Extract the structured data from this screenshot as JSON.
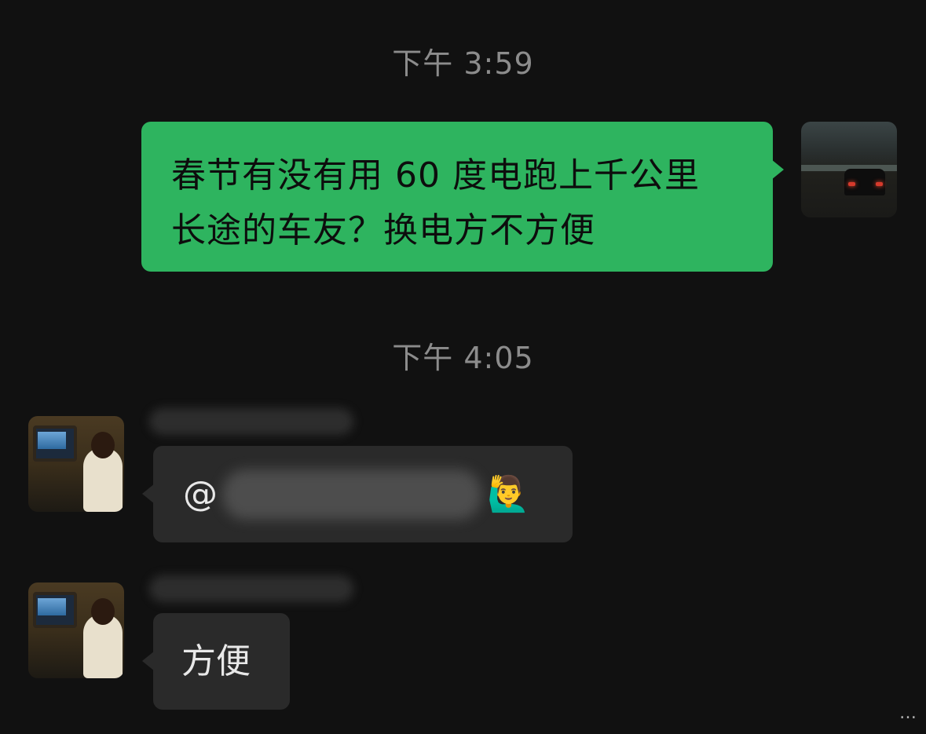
{
  "chat": {
    "timestamps": [
      "下午 3:59",
      "下午 4:05"
    ],
    "outgoing": {
      "line1": "春节有没有用 60 度电跑上千公里",
      "line2": "长途的车友？换电方不方便"
    },
    "incoming": [
      {
        "mention_prefix": "@",
        "mention_emoji": "🙋‍♂️"
      },
      {
        "text": "方便"
      }
    ],
    "corner_mark": "…"
  },
  "icons": {
    "my_avatar": "car-taillights-avatar-icon",
    "other_avatar": "person-playing-games-avatar-icon"
  },
  "colors": {
    "background": "#111111",
    "outgoing_bubble": "#2eb45f",
    "incoming_bubble": "#2a2a2a",
    "timestamp_text": "#8c8c8c"
  }
}
